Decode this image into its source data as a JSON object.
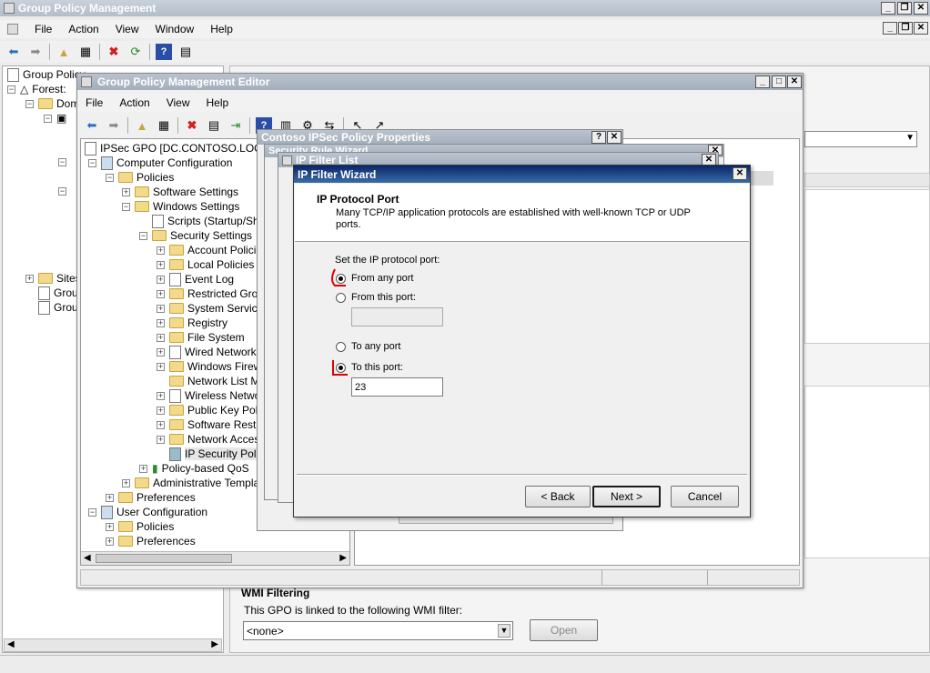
{
  "gpm": {
    "title": "Group Policy Management",
    "menu": [
      "File",
      "Action",
      "View",
      "Window",
      "Help"
    ],
    "tree": [
      "Group Policy",
      "Forest:",
      "Dom",
      "Sites",
      "Grou",
      "Grou"
    ],
    "wmi": {
      "heading": "WMI Filtering",
      "label": "This GPO is linked to the following WMI filter:",
      "value": "<none>",
      "open_label": "Open"
    }
  },
  "gpme": {
    "title": "Group Policy Management Editor",
    "menu": [
      "File",
      "Action",
      "View",
      "Help"
    ],
    "tree": [
      "IPSec GPO [DC.CONTOSO.LOCAL]",
      "Computer Configuration",
      "Policies",
      "Software Settings",
      "Windows Settings",
      "Scripts (Startup/Shu",
      "Security Settings",
      "Account Policies",
      "Local Policies",
      "Event Log",
      "Restricted Grou",
      "System Service",
      "Registry",
      "File System",
      "Wired Network",
      "Windows Firewa",
      "Network List Ma",
      "Wireless Netwo",
      "Public Key Polici",
      "Software Restr",
      "Network Access",
      "IP Security Polic",
      "Policy-based QoS",
      "Administrative Template",
      "Preferences",
      "User Configuration",
      "Policies",
      "Preferences"
    ]
  },
  "props": {
    "title": "Contoso IPSec Policy Properties"
  },
  "rulewiz": {
    "title": "Security Rule Wizard"
  },
  "filterlist": {
    "title": "IP Filter List"
  },
  "wizard": {
    "title": "IP Filter Wizard",
    "heading": "IP Protocol Port",
    "subheading": "Many TCP/IP application protocols are established with well-known TCP or UDP ports.",
    "set_label": "Set the IP protocol port:",
    "from_any": "From any port",
    "from_this": "From this port:",
    "from_value": "",
    "to_any": "To any port",
    "to_this": "To this port:",
    "to_value": "23",
    "back": "< Back",
    "next": "Next >",
    "cancel": "Cancel",
    "selected_from": "From any port",
    "selected_to": "To this port:"
  },
  "colors": {
    "annotation": "#e00000",
    "active_title": "#0a246a"
  }
}
